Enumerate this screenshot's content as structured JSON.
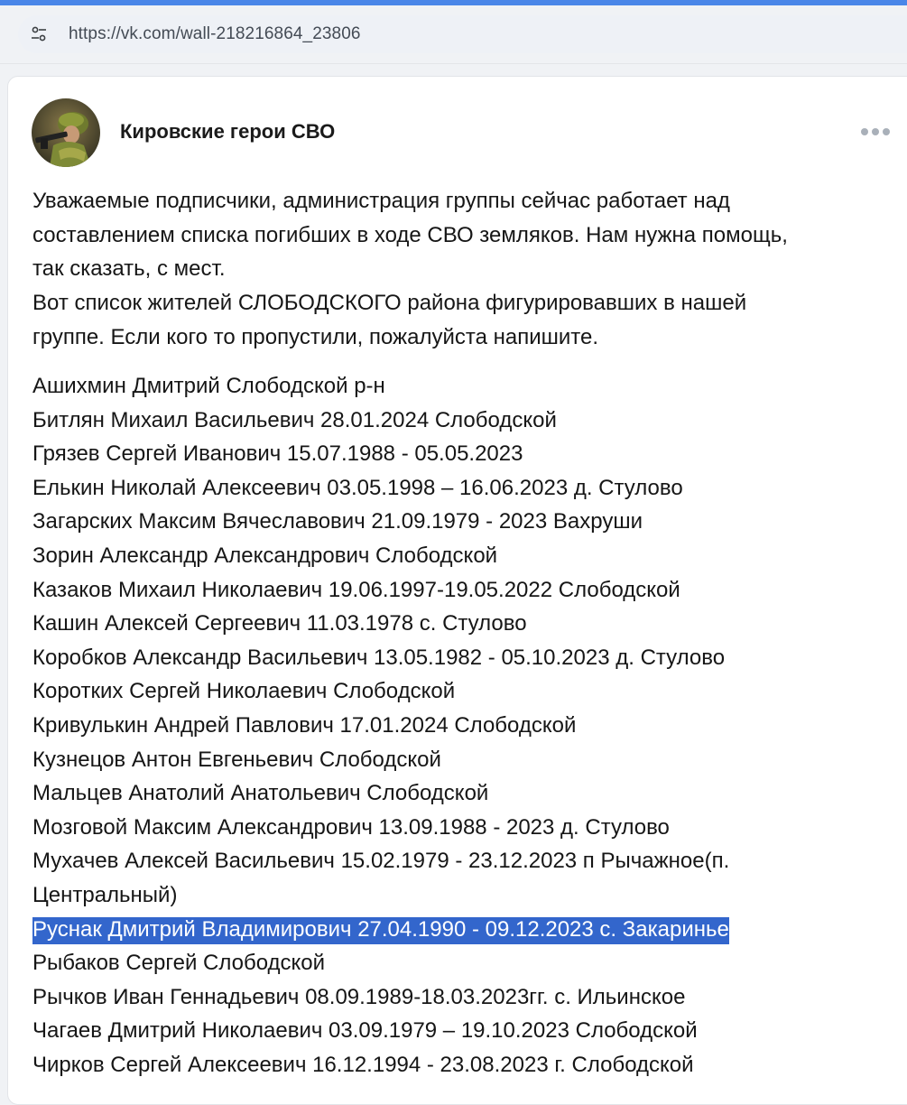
{
  "browser": {
    "url": "https://vk.com/wall-218216864_23806",
    "site_icon": "tune-icon"
  },
  "post": {
    "group_name": "Кировские герои СВО",
    "more_icon": "more-horizontal-icon",
    "intro_lines": [
      "Уважаемые подписчики, администрация группы сейчас работает над",
      "составлением списка погибших в ходе СВО земляков. Нам нужна помощь,",
      "так сказать, с мест.",
      "Вот список жителей СЛОБОДСКОГО района фигурировавших в нашей",
      "группе. Если кого то пропустили, пожалуйста напишите."
    ],
    "names": [
      "Ашихмин Дмитрий Слободской р-н",
      "Битлян Михаил Васильевич 28.01.2024 Слободской",
      "Грязев Сергей Иванович 15.07.1988 - 05.05.2023",
      "Елькин Николай Алексеевич 03.05.1998 – 16.06.2023 д. Стулово",
      "Загарских Максим Вячеславович 21.09.1979 - 2023 Вахруши",
      "Зорин Александр Александрович Слободской",
      "Казаков Михаил Николаевич 19.06.1997-19.05.2022 Слободской",
      "Кашин Алексей Сергеевич 11.03.1978 с. Стулово",
      "Коробков Александр Васильевич 13.05.1982 - 05.10.2023 д. Стулово",
      "Коротких Сергей Николаевич Слободской",
      "Кривулькин Андрей Павлович 17.01.2024 Слободской",
      "Кузнецов Антон Евгеньевич Слободской",
      "Мальцев Анатолий Анатольевич Слободской",
      "Мозговой Максим Александрович 13.09.1988 - 2023 д. Стулово",
      "Мухачев Алексей Васильевич 15.02.1979 - 23.12.2023 п Рычажное(п. Центральный)",
      "Руснак Дмитрий Владимирович 27.04.1990 - 09.12.2023 с. Закаринье",
      "Рыбаков Сергей Слободской",
      "Рычков Иван Геннадьевич 08.09.1989-18.03.2023гг. с. Ильинское",
      "Чагаев Дмитрий Николаевич 03.09.1979 – 19.10.2023 Слободской",
      "Чирков Сергей Алексеевич 16.12.1994 - 23.08.2023 г. Слободской"
    ]
  },
  "colors": {
    "selection": "#3366cc",
    "text": "#161616",
    "accent_bar": "#4a86e8"
  }
}
